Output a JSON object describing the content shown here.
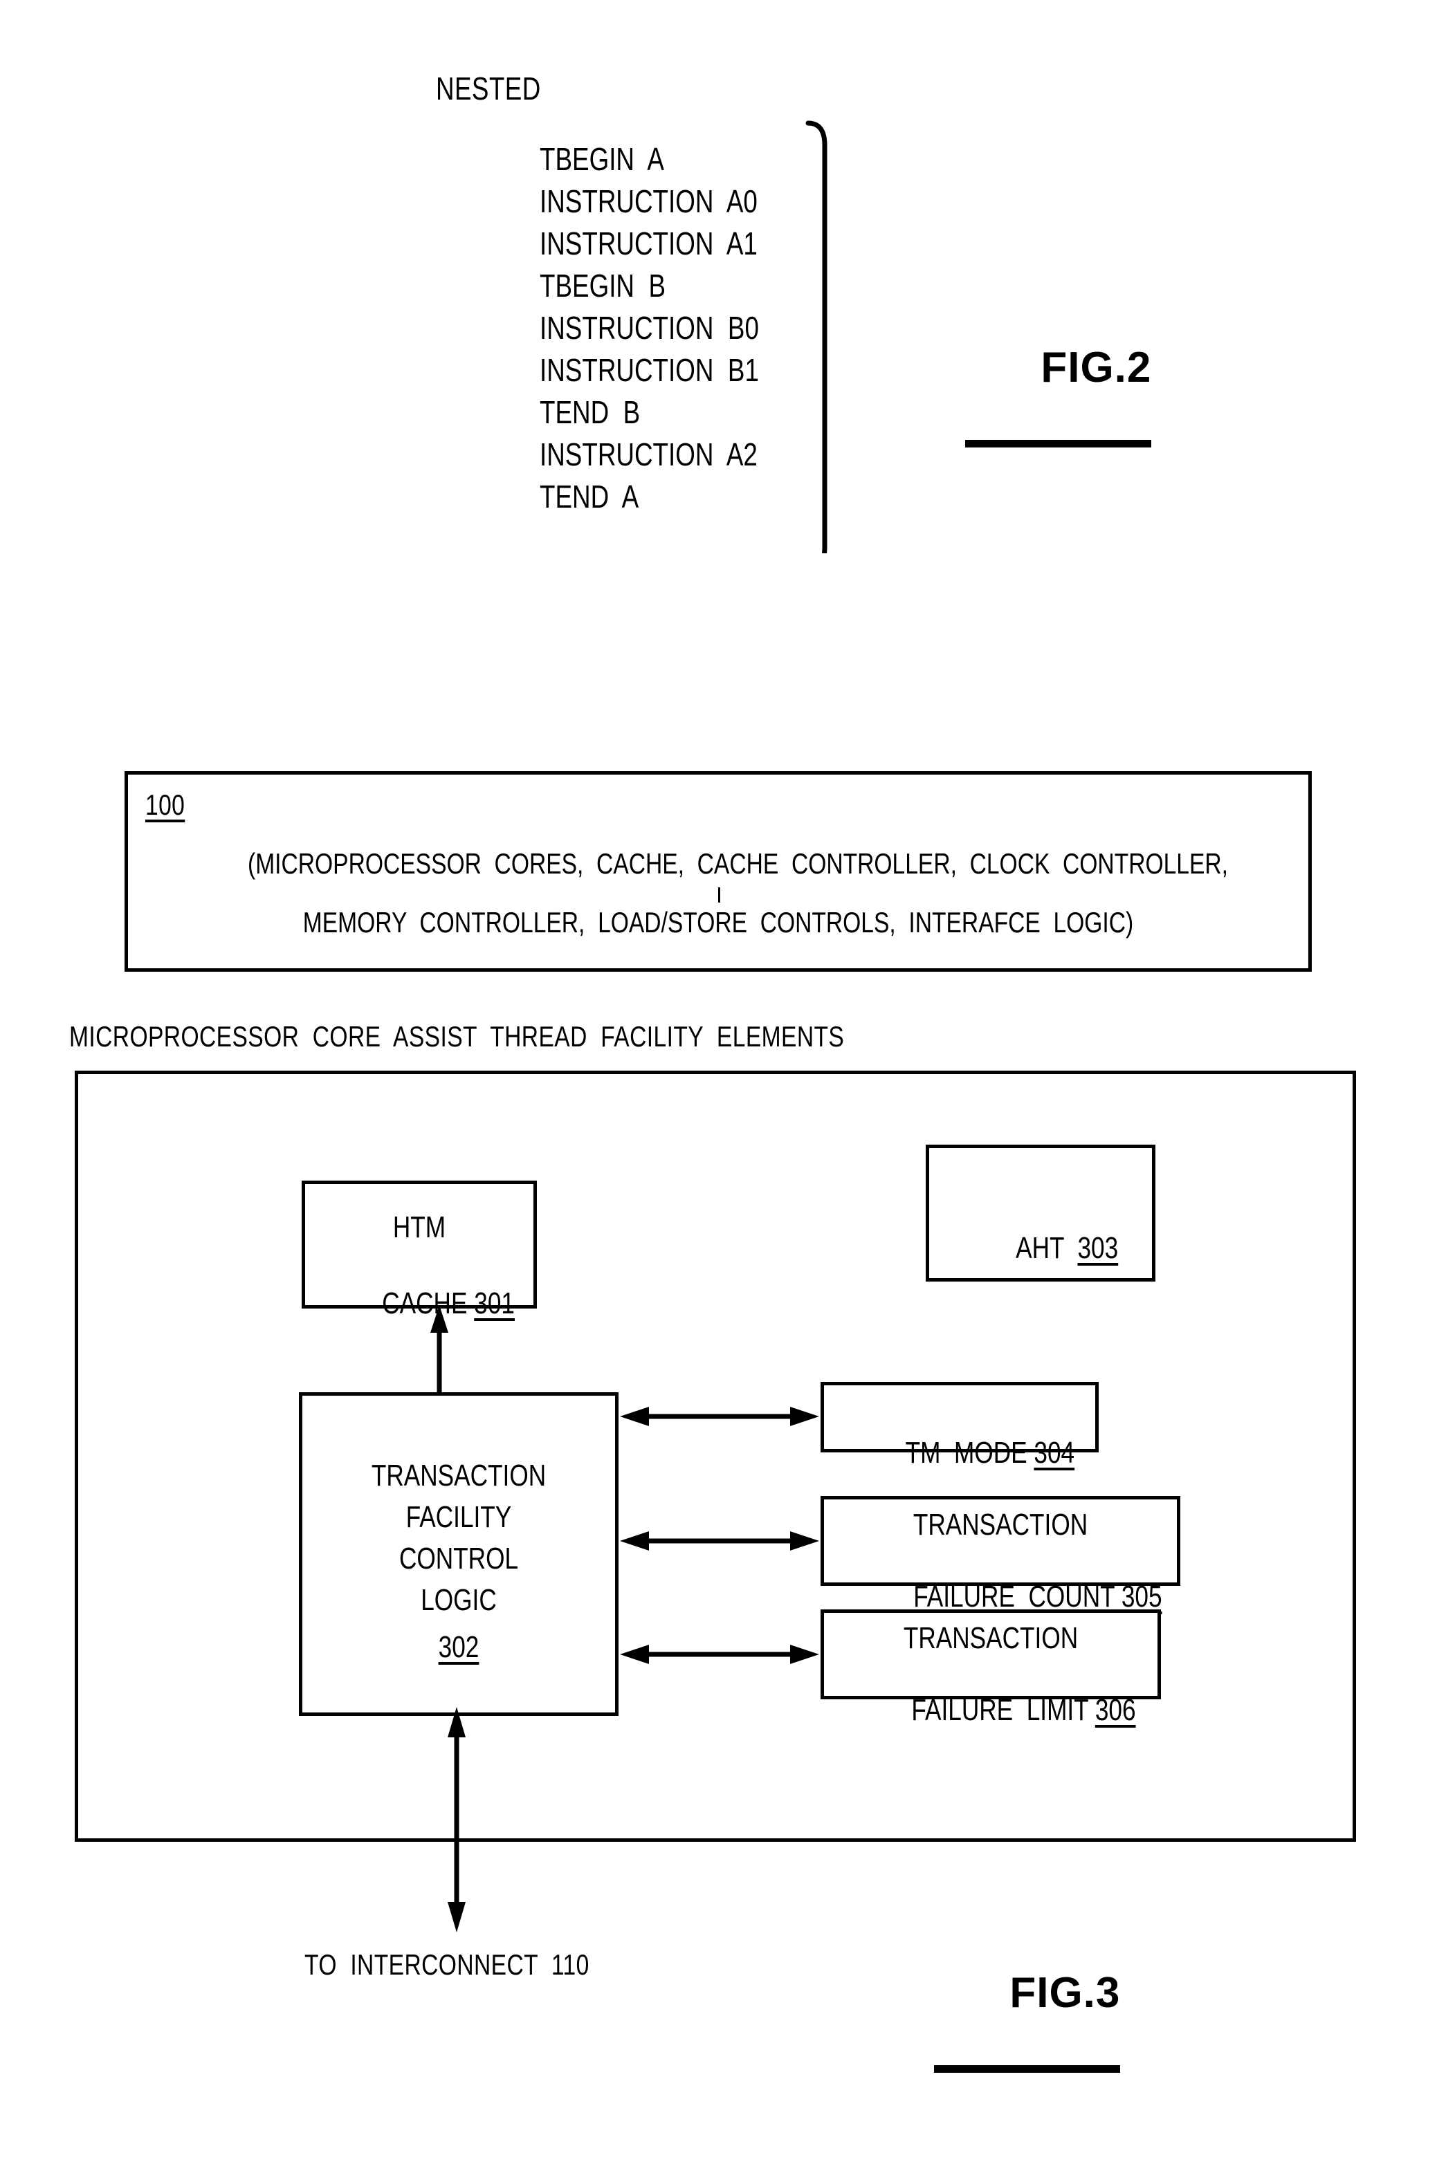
{
  "figure2": {
    "heading": "NESTED",
    "fig_label": "FIG.2",
    "code_lines": [
      "TBEGIN  A",
      "INSTRUCTION  A0",
      "INSTRUCTION  A1",
      "TBEGIN  B",
      "INSTRUCTION  B0",
      "INSTRUCTION  B1",
      "TEND  B",
      "INSTRUCTION  A2",
      "TEND  A"
    ]
  },
  "figure3": {
    "fig_label": "FIG.3",
    "system_box": {
      "ref": "100",
      "line1": "(MICROPROCESSOR  CORES,  CACHE,  CACHE  CONTROLLER,  CLOCK  CONTROLLER,",
      "line2": "MEMORY  CONTROLLER,  LOAD/STORE  CONTROLS,  INTERAFCE  LOGIC)"
    },
    "container_caption": "MICROPROCESSOR  CORE  ASSIST  THREAD  FACILITY  ELEMENTS",
    "blocks": {
      "htm_cache": {
        "line1": "HTM",
        "line2": "CACHE",
        "ref": "301"
      },
      "aht": {
        "line1": "AHT",
        "ref": "303"
      },
      "control_logic": {
        "line1": "TRANSACTION",
        "line2": "FACILITY",
        "line3": "CONTROL",
        "line4": "LOGIC",
        "ref": "302"
      },
      "tm_mode": {
        "line1": "TM  MODE",
        "ref": "304"
      },
      "failure_count": {
        "line1": "TRANSACTION",
        "line2": "FAILURE  COUNT",
        "ref": "305"
      },
      "failure_limit": {
        "line1": "TRANSACTION",
        "line2": "FAILURE  LIMIT",
        "ref": "306"
      }
    },
    "interconnect_label": "TO  INTERCONNECT  110"
  },
  "colors": {
    "ink": "#000000",
    "paper": "#ffffff"
  }
}
